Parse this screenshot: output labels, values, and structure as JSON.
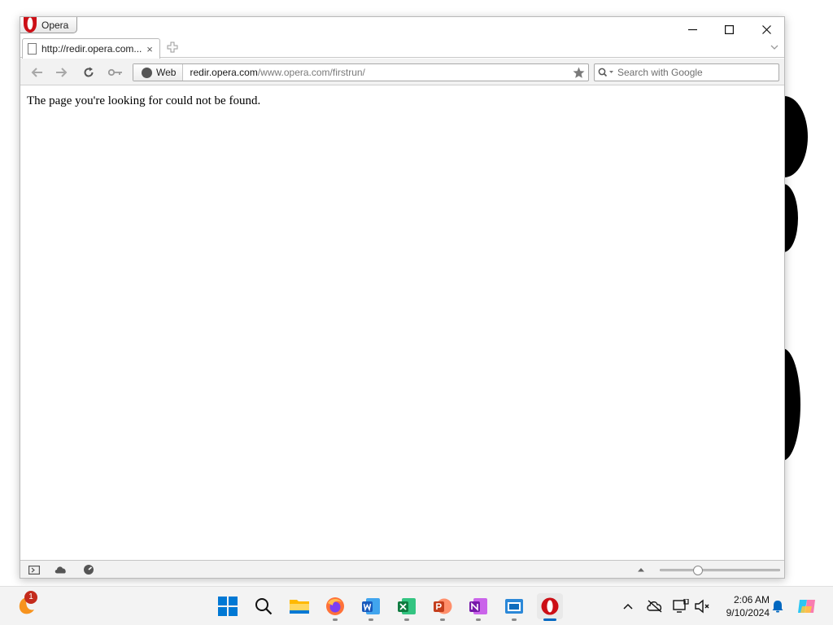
{
  "window": {
    "menu_label": "Opera",
    "controls": {
      "minimize": "minimize",
      "maximize": "maximize",
      "close": "close"
    }
  },
  "tab": {
    "title": "http://redir.opera.com...",
    "close": "×"
  },
  "nav": {
    "address": {
      "badge": "Web",
      "host": "redir.opera.com",
      "path": "/www.opera.com/firstrun/"
    },
    "search": {
      "placeholder": "Search with Google"
    }
  },
  "page": {
    "message": "The page you're looking for could not be found."
  },
  "statusbar": {
    "zoom_level": 0.3
  },
  "taskbar": {
    "notification_count": "1",
    "apps": [
      "start-icon",
      "search-icon",
      "file-explorer-icon",
      "firefox-icon",
      "word-icon",
      "excel-icon",
      "powerpoint-icon",
      "onenote-icon",
      "app-window-icon",
      "opera-icon"
    ],
    "clock": {
      "time": "2:06 AM",
      "date": "9/10/2024"
    }
  },
  "colors": {
    "accent": "#0067c0",
    "opera_red": "#cc0f16",
    "badge_red": "#c42b1c"
  }
}
